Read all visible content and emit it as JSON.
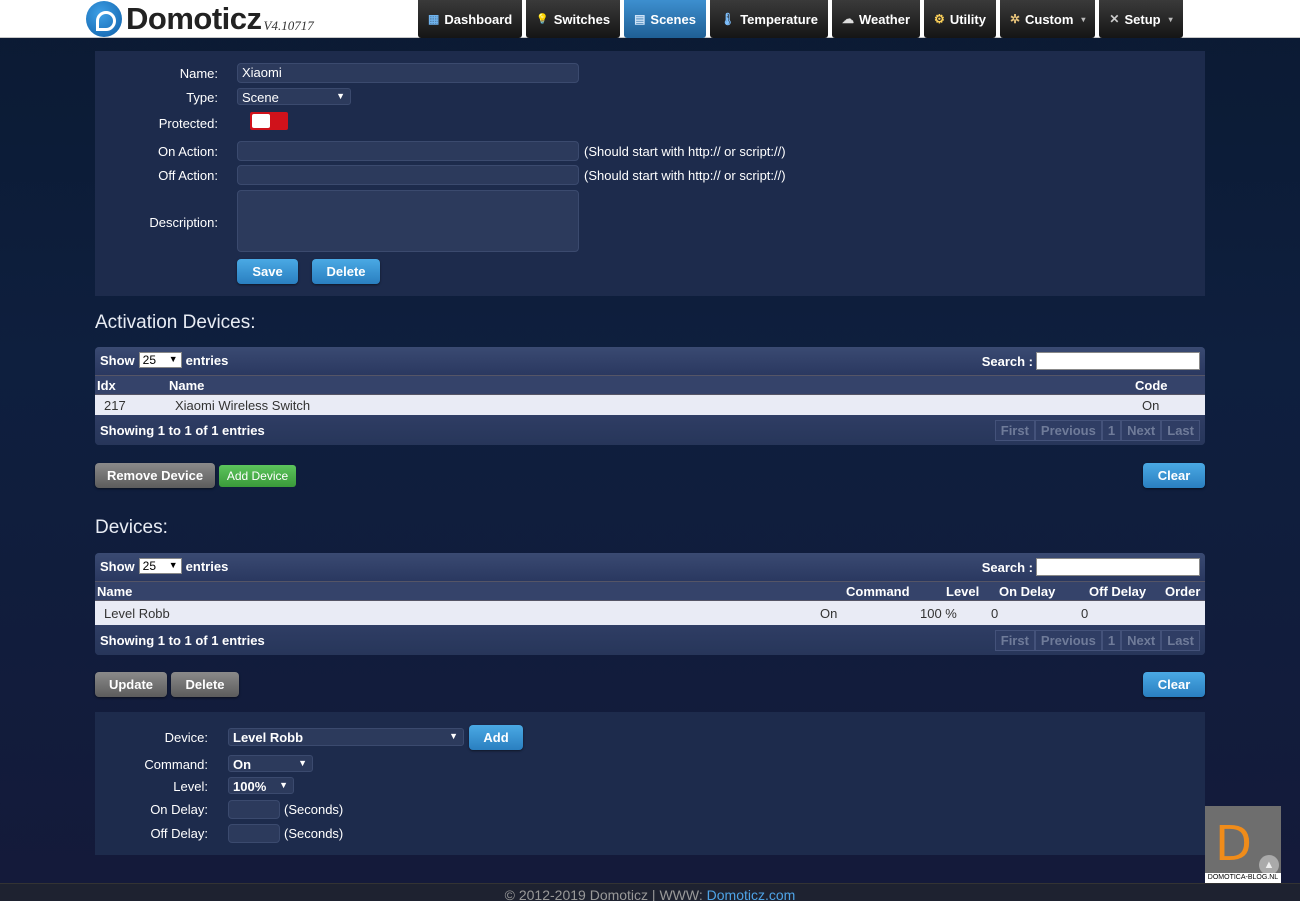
{
  "app": {
    "name": "Domoticz",
    "version": "V4.10717"
  },
  "nav": [
    {
      "label": "Dashboard",
      "icon": "dashboard-icon",
      "glyph": "▦",
      "active": false
    },
    {
      "label": "Switches",
      "icon": "lightbulb-icon",
      "glyph": "💡",
      "active": false
    },
    {
      "label": "Scenes",
      "icon": "scene-icon",
      "glyph": "▤",
      "active": true
    },
    {
      "label": "Temperature",
      "icon": "thermometer-icon",
      "glyph": "🌡",
      "active": false
    },
    {
      "label": "Weather",
      "icon": "cloud-icon",
      "glyph": "☁",
      "active": false
    },
    {
      "label": "Utility",
      "icon": "utility-icon",
      "glyph": "⚙",
      "active": false
    },
    {
      "label": "Custom",
      "icon": "gear-icon",
      "glyph": "✲",
      "active": false,
      "caret": "▾"
    },
    {
      "label": "Setup",
      "icon": "tools-icon",
      "glyph": "✕",
      "active": false,
      "caret": "▾"
    }
  ],
  "scene_form": {
    "name_label": "Name:",
    "name_value": "Xiaomi",
    "type_label": "Type:",
    "type_value": "Scene",
    "protected_label": "Protected:",
    "on_action_label": "On Action:",
    "on_action_hint": "(Should start with http:// or script://)",
    "off_action_label": "Off Action:",
    "off_action_hint": "(Should start with http:// or script://)",
    "description_label": "Description:",
    "save_label": "Save",
    "delete_label": "Delete"
  },
  "activation": {
    "title": "Activation Devices:",
    "show_label": "Show",
    "entries_value": "25",
    "entries_label": "entries",
    "search_label": "Search :",
    "columns": [
      "Idx",
      "Name",
      "Code"
    ],
    "rows": [
      {
        "idx": "217",
        "name": "Xiaomi Wireless Switch",
        "code": "On"
      }
    ],
    "info": "Showing 1 to 1 of 1 entries",
    "pager": [
      "First",
      "Previous",
      "1",
      "Next",
      "Last"
    ],
    "remove_label": "Remove Device",
    "add_label": "Add Device",
    "clear_label": "Clear"
  },
  "devices": {
    "title": "Devices:",
    "show_label": "Show",
    "entries_value": "25",
    "entries_label": "entries",
    "search_label": "Search :",
    "columns": [
      "Name",
      "Command",
      "Level",
      "On Delay",
      "Off Delay",
      "Order"
    ],
    "rows": [
      {
        "name": "Level Robb",
        "command": "On",
        "level": "100 %",
        "on_delay": "0",
        "off_delay": "0",
        "order": ""
      }
    ],
    "info": "Showing 1 to 1 of 1 entries",
    "pager": [
      "First",
      "Previous",
      "1",
      "Next",
      "Last"
    ],
    "update_label": "Update",
    "delete_label": "Delete",
    "clear_label": "Clear"
  },
  "add_form": {
    "device_label": "Device:",
    "device_value": "Level Robb",
    "add_label": "Add",
    "command_label": "Command:",
    "command_value": "On",
    "level_label": "Level:",
    "level_value": "100%",
    "on_delay_label": "On Delay:",
    "on_delay_unit": "(Seconds)",
    "off_delay_label": "Off Delay:",
    "off_delay_unit": "(Seconds)"
  },
  "footer": {
    "text": "© 2012-2019 Domoticz | WWW: ",
    "link": "Domoticz.com"
  },
  "watermark": {
    "letter": "D",
    "text": "DOMOTICA-BLOG.NL"
  },
  "colors": {
    "accent_blue": "#2a7fc0",
    "toggle_red": "#d0121b",
    "add_green": "#3a9a3a",
    "watermark_orange": "#f08c1a"
  }
}
